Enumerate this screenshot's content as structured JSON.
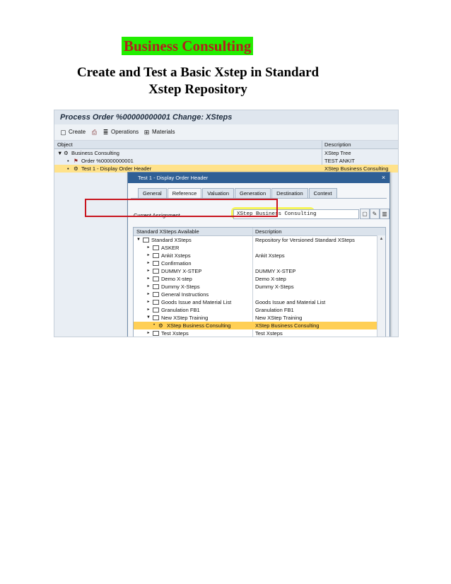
{
  "doc": {
    "brand": "Business Consulting",
    "title_line1": "Create and Test a Basic Xstep in Standard",
    "title_line2": "Xstep Repository"
  },
  "sap": {
    "window_title": "Process Order %00000000001 Change: XSteps",
    "toolbar": {
      "create": "Create",
      "operations": "Operations",
      "materials": "Materials"
    },
    "grid_headers": {
      "object": "Object",
      "description": "Description"
    },
    "rows": [
      {
        "arrow": "▼",
        "label": "Business Consulting",
        "desc": "XStep Tree",
        "selected": false
      },
      {
        "arrow": "•",
        "label": "Order %00000000001",
        "desc": "TEST ANKIT",
        "selected": false
      },
      {
        "arrow": "•",
        "label": "Test 1 - Display Order Header",
        "desc": "XStep Business Consulting",
        "selected": true
      }
    ]
  },
  "dialog": {
    "title": "Test 1 - Display Order Header",
    "close_icon": "×",
    "tabs": [
      "General",
      "Reference",
      "Valuation",
      "Generation",
      "Destination",
      "Context"
    ],
    "active_tab": "Reference",
    "current_assignment_label": "Current Assignment",
    "current_assignment_value": "XStep Business Consulting",
    "tree_headers": {
      "name": "Standard XSteps Available",
      "description": "Description"
    },
    "tree_rows": [
      {
        "arrow": "▼",
        "label": "Standard XSteps",
        "desc": "Repository for Versioned Standard XSteps"
      },
      {
        "arrow": "▸",
        "label": "ASKER",
        "desc": ""
      },
      {
        "arrow": "▸",
        "label": "Ankit Xsteps",
        "desc": "Ankit Xsteps"
      },
      {
        "arrow": "▸",
        "label": "Confirmation",
        "desc": ""
      },
      {
        "arrow": "▸",
        "label": "DUMMY X-STEP",
        "desc": "DUMMY X-STEP"
      },
      {
        "arrow": "▸",
        "label": "Demo X-step",
        "desc": "Demo X-step"
      },
      {
        "arrow": "▸",
        "label": "Dummy X-Steps",
        "desc": "Dummy X-Steps"
      },
      {
        "arrow": "▸",
        "label": "General Instructions",
        "desc": ""
      },
      {
        "arrow": "▸",
        "label": "Goods Issue and Material List",
        "desc": "Goods Issue and Material List"
      },
      {
        "arrow": "▸",
        "label": "Granulation FB1",
        "desc": "Granulation FB1"
      },
      {
        "arrow": "▼",
        "label": "New XStep Training",
        "desc": "New XStep Training"
      },
      {
        "arrow": "•",
        "label": "XStep Business Consulting",
        "desc": "XStep Business Consulting"
      },
      {
        "arrow": "▸",
        "label": "Test Xsteps",
        "desc": "Test Xsteps"
      }
    ]
  },
  "colors": {
    "brand_bg": "#22ee00",
    "brand_text": "#b3211d",
    "highlight": "#f4f53c",
    "red_box": "#c8141e"
  }
}
